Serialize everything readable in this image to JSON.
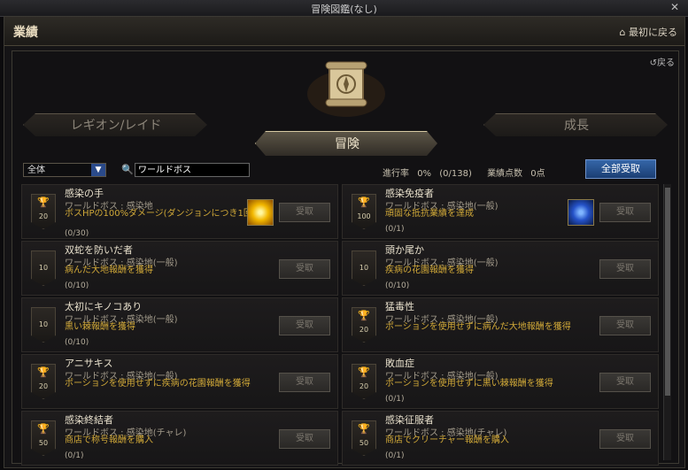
{
  "window": {
    "title": "冒険図鑑(なし)"
  },
  "header": {
    "title": "業績",
    "home_label": "最初に戻る",
    "back_label": "戻る"
  },
  "tabs": {
    "left": "レギオン/レイド",
    "center": "冒険",
    "right": "成長"
  },
  "filter": {
    "selected": "全体"
  },
  "search": {
    "value": "ワールドボス"
  },
  "progress": {
    "rate_label": "進行率",
    "rate_value": "0%",
    "rate_count": "(0/138)",
    "points_label": "業績点数",
    "points_value": "0点"
  },
  "claim_all": "全部受取",
  "claim_label": "受取",
  "cards": [
    {
      "name": "感染の手",
      "sub": "ワールドボス : 感染地",
      "desc": "ボスHPの100%ダメージ(ダンジョンにつき1回)",
      "count": "(0/30)",
      "badge": "20",
      "reward": "gold"
    },
    {
      "name": "感染免疫者",
      "sub": "ワールドボス : 感染地(一般)",
      "desc": "頑固な抵抗業績を達成",
      "count": "(0/1)",
      "badge": "100",
      "reward": "blue"
    },
    {
      "name": "双蛇を防いだ者",
      "sub": "ワールドボス : 感染地(一般)",
      "desc": "病んだ大地報酬を獲得",
      "count": "(0/10)",
      "badge": "10"
    },
    {
      "name": "頭か尾か",
      "sub": "ワールドボス : 感染地(一般)",
      "desc": "疾病の花園報酬を獲得",
      "count": "(0/10)",
      "badge": "10"
    },
    {
      "name": "太初にキノコあり",
      "sub": "ワールドボス : 感染地(一般)",
      "desc": "黒い棘報酬を獲得",
      "count": "(0/10)",
      "badge": "10"
    },
    {
      "name": "猛毒性",
      "sub": "ワールドボス : 感染地(一般)",
      "desc": "ポーションを使用せずに病んだ大地報酬を獲得",
      "count": "",
      "badge": "20"
    },
    {
      "name": "アニサキス",
      "sub": "ワールドボス : 感染地(一般)",
      "desc": "ポーションを使用せずに疾病の花園報酬を獲得",
      "count": "",
      "badge": "20"
    },
    {
      "name": "敗血症",
      "sub": "ワールドボス : 感染地(一般)",
      "desc": "ポーションを使用せずに黒い棘報酬を獲得",
      "count": "(0/1)",
      "badge": "20"
    },
    {
      "name": "感染終結者",
      "sub": "ワールドボス : 感染地(チャレ)",
      "desc": "商店で称号報酬を購入",
      "count": "(0/1)",
      "badge": "50"
    },
    {
      "name": "感染征服者",
      "sub": "ワールドボス : 感染地(チャレ)",
      "desc": "商店でクリーチャー報酬を購入",
      "count": "(0/1)",
      "badge": "50"
    }
  ]
}
